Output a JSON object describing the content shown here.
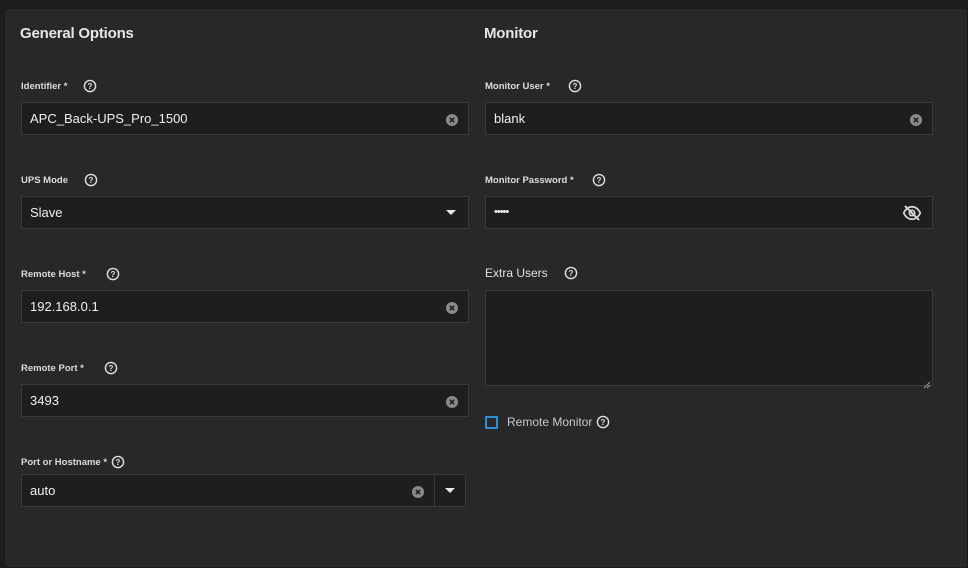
{
  "general": {
    "title": "General Options",
    "identifier": {
      "label": "Identifier *",
      "value": "APC_Back-UPS_Pro_1500"
    },
    "ups_mode": {
      "label": "UPS Mode",
      "value": "Slave"
    },
    "remote_host": {
      "label": "Remote Host *",
      "value": "192.168.0.1"
    },
    "remote_port": {
      "label": "Remote Port *",
      "value": "3493"
    },
    "port_or_hostname": {
      "label": "Port or Hostname *",
      "value": "auto"
    }
  },
  "monitor": {
    "title": "Monitor",
    "monitor_user": {
      "label": "Monitor User *",
      "value": "blank"
    },
    "monitor_password": {
      "label": "Monitor Password *",
      "value": "•••••"
    },
    "extra_users": {
      "label": "Extra Users",
      "value": ""
    },
    "remote_monitor": {
      "label": "Remote Monitor",
      "checked": false
    }
  },
  "colors": {
    "background": "#1e1e1e",
    "card": "#282828",
    "field_bg": "#1e1e1e",
    "field_border": "#3a3a3a",
    "checkbox_accent": "#2e8fd4"
  }
}
